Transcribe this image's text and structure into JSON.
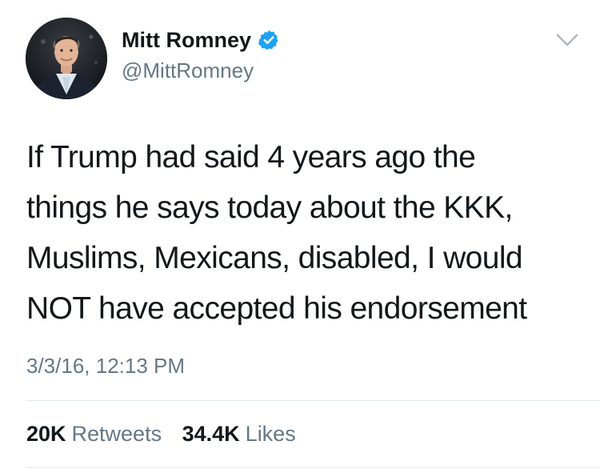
{
  "author": {
    "name": "Mitt Romney",
    "handle": "@MittRomney",
    "verified": true,
    "avatar_icon": "profile-photo",
    "verified_icon": "verified-badge-icon"
  },
  "menu_icon": "chevron-down-icon",
  "tweet": {
    "lines": [
      "If Trump had said 4 years ago the",
      "things he says today about the KKK,",
      "Muslims, Mexicans, disabled, I would",
      "NOT have accepted his endorsement"
    ],
    "timestamp": "3/3/16, 12:13 PM"
  },
  "stats": {
    "retweets_count": "20K",
    "retweets_label": "Retweets",
    "likes_count": "34.4K",
    "likes_label": "Likes"
  },
  "colors": {
    "text_primary": "#14171a",
    "text_secondary": "#657786",
    "verified_blue": "#1da1f2",
    "divider": "#e1e8ed"
  }
}
